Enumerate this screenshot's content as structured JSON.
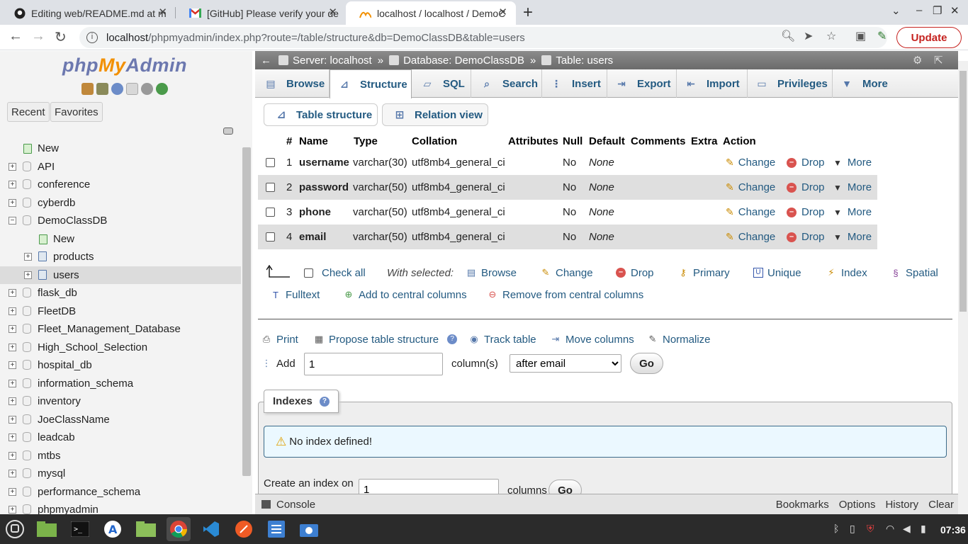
{
  "browser": {
    "tabs": [
      {
        "title": "Editing web/README.md at m",
        "icon": "github-icon"
      },
      {
        "title": "[GitHub] Please verify your de",
        "icon": "gmail-icon"
      },
      {
        "title": "localhost / localhost / DemoC",
        "icon": "phpmyadmin-icon",
        "active": true
      }
    ],
    "url_host": "localhost",
    "url_path": "/phpmyadmin/index.php?route=/table/structure&db=DemoClassDB&table=users",
    "update_label": "Update"
  },
  "sidebar": {
    "logo_php": "php",
    "logo_my": "My",
    "logo_admin": "Admin",
    "tabs": [
      "Recent",
      "Favorites"
    ],
    "tree": [
      {
        "label": "New",
        "level": 0,
        "type": "new"
      },
      {
        "label": "API",
        "level": 0,
        "type": "db"
      },
      {
        "label": "conference",
        "level": 0,
        "type": "db"
      },
      {
        "label": "cyberdb",
        "level": 0,
        "type": "db"
      },
      {
        "label": "DemoClassDB",
        "level": 0,
        "type": "db",
        "expanded": true
      },
      {
        "label": "New",
        "level": 1,
        "type": "new"
      },
      {
        "label": "products",
        "level": 1,
        "type": "table"
      },
      {
        "label": "users",
        "level": 1,
        "type": "table",
        "selected": true
      },
      {
        "label": "flask_db",
        "level": 0,
        "type": "db"
      },
      {
        "label": "FleetDB",
        "level": 0,
        "type": "db"
      },
      {
        "label": "Fleet_Management_Database",
        "level": 0,
        "type": "db"
      },
      {
        "label": "High_School_Selection",
        "level": 0,
        "type": "db"
      },
      {
        "label": "hospital_db",
        "level": 0,
        "type": "db"
      },
      {
        "label": "information_schema",
        "level": 0,
        "type": "db"
      },
      {
        "label": "inventory",
        "level": 0,
        "type": "db"
      },
      {
        "label": "JoeClassName",
        "level": 0,
        "type": "db"
      },
      {
        "label": "leadcab",
        "level": 0,
        "type": "db"
      },
      {
        "label": "mtbs",
        "level": 0,
        "type": "db"
      },
      {
        "label": "mysql",
        "level": 0,
        "type": "db"
      },
      {
        "label": "performance_schema",
        "level": 0,
        "type": "db"
      },
      {
        "label": "phpmyadmin",
        "level": 0,
        "type": "db"
      }
    ]
  },
  "breadcrumb": {
    "server": "Server: localhost",
    "database": "Database: DemoClassDB",
    "table": "Table: users",
    "sep": "»"
  },
  "menu": [
    "Browse",
    "Structure",
    "SQL",
    "Search",
    "Insert",
    "Export",
    "Import",
    "Privileges",
    "More"
  ],
  "subtabs": [
    "Table structure",
    "Relation view"
  ],
  "table": {
    "headers": [
      "#",
      "Name",
      "Type",
      "Collation",
      "Attributes",
      "Null",
      "Default",
      "Comments",
      "Extra",
      "Action"
    ],
    "rows": [
      {
        "num": "1",
        "name": "username",
        "type": "varchar(30)",
        "collation": "utf8mb4_general_ci",
        "null": "No",
        "default": "None"
      },
      {
        "num": "2",
        "name": "password",
        "type": "varchar(50)",
        "collation": "utf8mb4_general_ci",
        "null": "No",
        "default": "None"
      },
      {
        "num": "3",
        "name": "phone",
        "type": "varchar(50)",
        "collation": "utf8mb4_general_ci",
        "null": "No",
        "default": "None"
      },
      {
        "num": "4",
        "name": "email",
        "type": "varchar(50)",
        "collation": "utf8mb4_general_ci",
        "null": "No",
        "default": "None"
      }
    ],
    "actions": {
      "change": "Change",
      "drop": "Drop",
      "more": "More"
    }
  },
  "with_selected": {
    "check_all": "Check all",
    "label": "With selected:",
    "browse": "Browse",
    "change": "Change",
    "drop": "Drop",
    "primary": "Primary",
    "unique": "Unique",
    "index": "Index",
    "spatial": "Spatial",
    "fulltext": "Fulltext",
    "add_central": "Add to central columns",
    "remove_central": "Remove from central columns"
  },
  "tools": {
    "print": "Print",
    "propose": "Propose table structure",
    "track": "Track table",
    "move": "Move columns",
    "normalize": "Normalize"
  },
  "add_columns": {
    "label": "Add",
    "count": "1",
    "columns_label": "column(s)",
    "position": "after email",
    "go": "Go"
  },
  "indexes": {
    "title": "Indexes",
    "notice": "No index defined!",
    "create_label": "Create an index on",
    "count": "1",
    "columns_label": "columns",
    "go": "Go"
  },
  "console": {
    "label": "Console",
    "links": [
      "Bookmarks",
      "Options",
      "History",
      "Clear"
    ]
  },
  "taskbar": {
    "clock": "07:36"
  }
}
